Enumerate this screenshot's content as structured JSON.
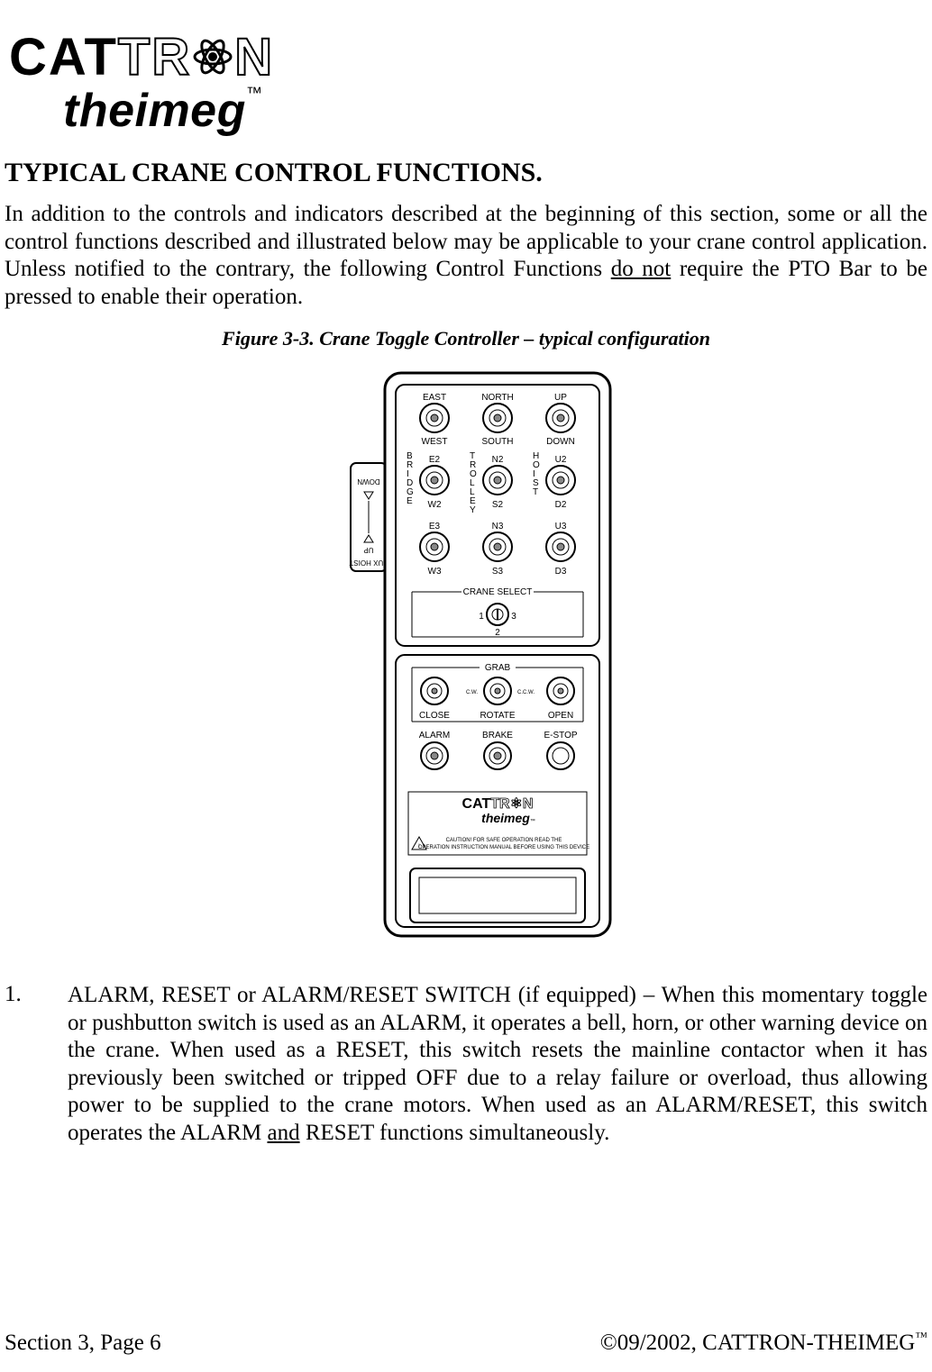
{
  "logo": {
    "brand_upper": "CATTRON",
    "brand_lower": "theimeg",
    "tm": "™"
  },
  "heading": "TYPICAL CRANE CONTROL FUNCTIONS.",
  "intro_before_underline": "In addition to the controls and indicators described at the beginning of this section, some or all the control functions described and illustrated below may be applicable to your crane control application. Unless notified to the contrary, the following Control Functions ",
  "intro_underline": "do not",
  "intro_after_underline": " require the PTO Bar to be pressed to enable their operation.",
  "figure_caption": "Figure 3-3.  Crane Toggle Controller – typical configuration",
  "controller": {
    "side_labels": {
      "top": "AUX HOIST",
      "up": "UP",
      "down": "DOWN"
    },
    "col_headers": {
      "c1_top": "EAST",
      "c1_bot": "WEST",
      "c2_top": "NORTH",
      "c2_bot": "SOUTH",
      "c3_top": "UP",
      "c3_bot": "DOWN"
    },
    "vert_labels": {
      "bridge": "BRIDGE",
      "trolley": "TROLLEY",
      "hoist": "HOIST"
    },
    "row2": {
      "c1t": "E2",
      "c1b": "W2",
      "c2t": "N2",
      "c2b": "S2",
      "c3t": "U2",
      "c3b": "D2"
    },
    "row3": {
      "c1t": "E3",
      "c1b": "W3",
      "c2t": "N3",
      "c2b": "S3",
      "c3t": "U3",
      "c3b": "D3"
    },
    "crane_select": {
      "title": "CRANE SELECT",
      "l": "1",
      "r": "3",
      "b": "2"
    },
    "grab": {
      "title": "GRAB",
      "cw": "C.W.",
      "ccw": "C.C.W.",
      "close": "CLOSE",
      "rotate": "ROTATE",
      "open": "OPEN"
    },
    "bottom_row": {
      "alarm": "ALARM",
      "brake": "BRAKE",
      "estop": "E-STOP"
    },
    "brand_upper": "CATTRON",
    "brand_lower": "theimeg",
    "tm": "™",
    "caution": "CAUTION! FOR SAFE OPERATION READ THE\nOPERATION INSTRUCTION MANUAL BEFORE USING THIS DEVICE"
  },
  "list": {
    "num": "1.",
    "t1": "ALARM, RESET or ALARM/RESET SWITCH (if equipped) – When this momentary toggle or pushbutton switch is used as an ALARM, it operates a bell, horn, or other warning device on the crane.  When used as a RESET, this switch resets the mainline contactor when it has previously been switched or tripped OFF due to a relay failure or overload, thus allowing power to be supplied to the crane motors.  When used as an ALARM/RESET, this switch operates the ALARM ",
    "u": "and",
    "t2": " RESET functions simultaneously."
  },
  "footer": {
    "left": "Section 3, Page 6",
    "right_prefix": "©09/2002, CATTRON-THEIMEG",
    "right_tm": "™"
  }
}
